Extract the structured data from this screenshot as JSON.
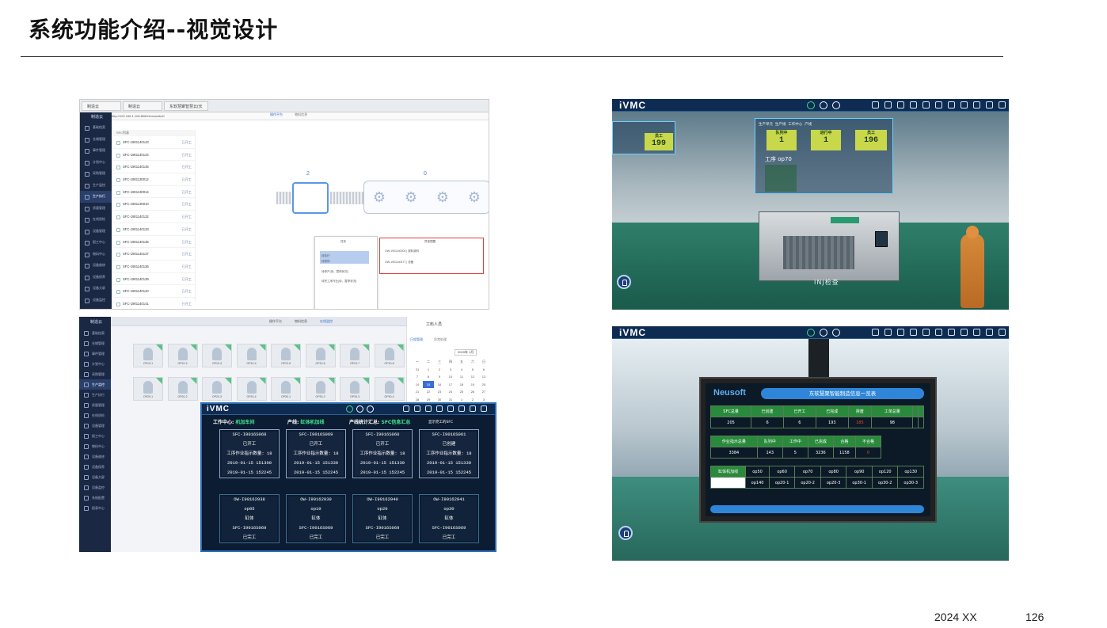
{
  "slide": {
    "title": "系统功能介绍--视觉设计",
    "footer_year": "2024 XX",
    "page_number": "126"
  },
  "shot_a": {
    "browser_tabs": [
      "制造云",
      "制造云",
      "东软慧聚智慧云(长春)"
    ],
    "address": "http://192.168.1.106:8080/ivmcweb/#/",
    "sidebar_logo": "制造云",
    "sidebar_items": [
      "基础档案",
      "仓储管理",
      "事件管理",
      "计划中心",
      "采购管理",
      "生产监控",
      "生产执行",
      "质量管理",
      "在线质检",
      "设备管理",
      "报工中心",
      "物料中心",
      "设备维修",
      "设备保养",
      "设备大屏",
      "设备监控",
      "系统配置",
      "报表中心"
    ],
    "sidebar_active_index": 6,
    "tabs": [
      "操作平台",
      "物料信息"
    ],
    "list_header": "SFC列表",
    "list_rows": [
      {
        "id": "SFC-1901140143",
        "status": "已开工"
      },
      {
        "id": "SFC-1901140144",
        "status": "已开工"
      },
      {
        "id": "SFC-1901140145",
        "status": "已开工"
      },
      {
        "id": "SFC-1901130012",
        "status": "已开工"
      },
      {
        "id": "SFC-1901130014",
        "status": "已开工"
      },
      {
        "id": "SFC-1901130010",
        "status": "已开工"
      },
      {
        "id": "SFC-1901140132",
        "status": "已开工"
      },
      {
        "id": "SFC-1901140133",
        "status": "已开工"
      },
      {
        "id": "SFC-1901140135",
        "status": "已开工"
      },
      {
        "id": "SFC-1901140137",
        "status": "已开工"
      },
      {
        "id": "SFC-1901140136",
        "status": "已开工"
      },
      {
        "id": "SFC-1901140139",
        "status": "已开工"
      },
      {
        "id": "SFC-1901140140",
        "status": "已开工"
      },
      {
        "id": "SFC-1901140141",
        "status": "已开工"
      }
    ],
    "station_count_left": "2",
    "station_count_right": "0",
    "popup_title": "任务",
    "popup_lines": [
      "待执行",
      "待暂停",
      "待停产(待，暂停状况)",
      "待完工序作业(待，暂停状况)"
    ],
    "redbox_title": "异常提醒",
    "redbox_lines": [
      "OW-1901140004 | 报料缺料",
      "OW-1901140477 | 设备"
    ]
  },
  "shot_b": {
    "logo": "iVMC",
    "panel_header": [
      "生产单元",
      "生产线",
      "工作中心",
      "产线"
    ],
    "cards": [
      {
        "label": "员工",
        "value": "199"
      },
      {
        "label": "队列中",
        "value": "1"
      },
      {
        "label": "进行中",
        "value": "1"
      },
      {
        "label": "员工",
        "value": "196"
      }
    ],
    "op_label": "工序",
    "op_value": "op70",
    "machine_label": "INJ检查"
  },
  "shot_c": {
    "sidebar_logo": "制造云",
    "sidebar_items": [
      "基础档案",
      "仓储管理",
      "事件管理",
      "计划中心",
      "采购管理",
      "生产监控",
      "生产执行",
      "质量管理",
      "在线质检",
      "设备管理",
      "报工中心",
      "物料中心",
      "设备维修",
      "设备保养",
      "设备大屏",
      "设备监控",
      "系统配置",
      "报表中心"
    ],
    "sidebar_active_index": 5,
    "top_tabs": [
      "操作平台",
      "物料信息",
      "在线监控"
    ],
    "cards": [
      "OP10-1",
      "OP10-2",
      "OP10-3",
      "OP10-4",
      "OP10-5",
      "OP10-6",
      "OP10-7",
      "OP10-8",
      "OP20-1",
      "OP20-2",
      "OP20-3",
      "OP20-4",
      "OP30-1",
      "OP30-2",
      "OP30-3",
      "OP30-4"
    ],
    "calendar_user": "工料人员",
    "calendar_tabs": [
      "日程管理",
      "异常处理"
    ],
    "calendar_month": "2019年 1月",
    "weekdays": [
      "一",
      "二",
      "三",
      "四",
      "五",
      "六",
      "日"
    ],
    "days": [
      "31",
      "1",
      "2",
      "3",
      "4",
      "5",
      "6",
      "7",
      "8",
      "9",
      "10",
      "11",
      "12",
      "13",
      "14",
      "15",
      "16",
      "17",
      "18",
      "19",
      "20",
      "21",
      "22",
      "23",
      "24",
      "25",
      "26",
      "27",
      "28",
      "29",
      "30",
      "31",
      "1",
      "2",
      "3"
    ],
    "calendar_selected": "15",
    "overlay": {
      "logo": "iVMC",
      "work_center_label": "工作中心:",
      "work_center": "机加车间",
      "line_label": "产线:",
      "line": "缸体机加线",
      "sum_label": "产线统计汇总:",
      "sum_value": "SFC信息汇总",
      "show_finished": "显示完工的SFC",
      "top_cards": [
        [
          "SFC-I9016S068",
          "已开工",
          "工序作业指示数量: 18",
          "2019-01-15 151300",
          "2019-01-15 152245"
        ],
        [
          "SFC-I9016S069",
          "已开工",
          "工序作业指示数量: 18",
          "2019-01-15 151330",
          "2019-01-15 152245"
        ],
        [
          "SFC-I9016S060",
          "已开工",
          "工序作业指示数量: 18",
          "2019-01-15 151330",
          "2019-01-15 152245"
        ],
        [
          "SFC-I9016S061",
          "已创建",
          "工序作业指示数量: 18",
          "2019-01-15 151330",
          "2019-01-15 152245"
        ]
      ],
      "bottom_cards": [
        [
          "OW-I90162938",
          "op05",
          "缸体",
          "SFC-I9016S069",
          "已完工"
        ],
        [
          "OW-I90162939",
          "op10",
          "缸体",
          "SFC-I9016S069",
          "已完工"
        ],
        [
          "OW-I90162940",
          "op20",
          "缸体",
          "SFC-I9016S069",
          "已完工"
        ],
        [
          "OW-I90162941",
          "op30",
          "缸体",
          "SFC-I9016S069",
          "已完工"
        ]
      ]
    }
  },
  "shot_d": {
    "logo": "iVMC",
    "board_logo": "Neusoft",
    "board_title": "东软慧聚智能制造信息一览表",
    "table1_headers": [
      "SFC总量",
      "已创建",
      "已开工",
      "已完成",
      "排废",
      "工单总量",
      "",
      ""
    ],
    "table1_values": [
      "205",
      "6",
      "6",
      "193",
      "185",
      "98",
      "",
      ""
    ],
    "table2_headers": [
      "作业指示总量",
      "队列中",
      "工作中",
      "已完成",
      "合格",
      "不合格"
    ],
    "table2_values": [
      "3384",
      "143",
      "5",
      "3236",
      "1158",
      "0"
    ],
    "table3_label": "缸体机加线",
    "table3_row1": [
      "op50",
      "op60",
      "op70",
      "op80",
      "op90",
      "op120",
      "op130"
    ],
    "table3_row2": [
      "op140",
      "op20-1",
      "op20-2",
      "op20-3",
      "op30-1",
      "op30-2",
      "op30-3"
    ]
  }
}
